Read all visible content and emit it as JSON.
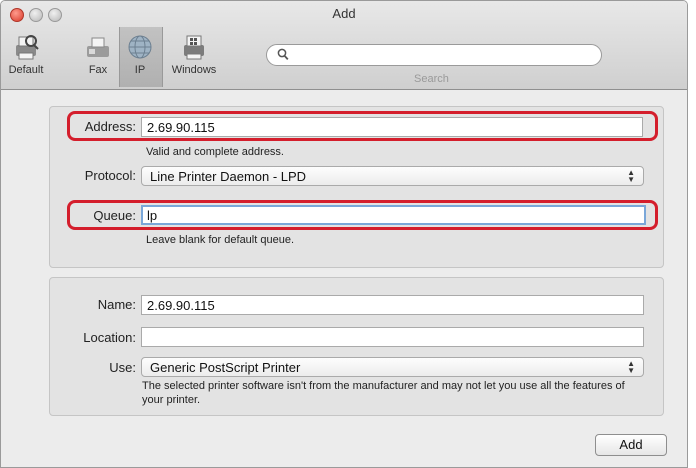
{
  "window": {
    "title": "Add"
  },
  "toolbar": {
    "items": [
      {
        "label": "Default",
        "icon": "default-printer-icon"
      },
      {
        "label": "Fax",
        "icon": "fax-icon"
      },
      {
        "label": "IP",
        "icon": "ip-globe-icon"
      },
      {
        "label": "Windows",
        "icon": "windows-printer-icon"
      }
    ],
    "selected": "IP",
    "search": {
      "value": "",
      "placeholder": "",
      "caption": "Search"
    }
  },
  "connection": {
    "address": {
      "label": "Address:",
      "value": "2.69.90.115",
      "hint": "Valid and complete address."
    },
    "protocol": {
      "label": "Protocol:",
      "selected": "Line Printer Daemon - LPD"
    },
    "queue": {
      "label": "Queue:",
      "value": "lp",
      "hint": "Leave blank for default queue."
    }
  },
  "printer": {
    "name": {
      "label": "Name:",
      "value": "2.69.90.115"
    },
    "location": {
      "label": "Location:",
      "value": ""
    },
    "use": {
      "label": "Use:",
      "selected": "Generic PostScript Printer"
    },
    "note": "The selected printer software isn't from the manufacturer and may not let you use all the features of your printer."
  },
  "footer": {
    "add_label": "Add"
  },
  "colors": {
    "highlight": "#d41e2c",
    "focus": "#7aa7d9",
    "panel": "#e3e3e3"
  }
}
